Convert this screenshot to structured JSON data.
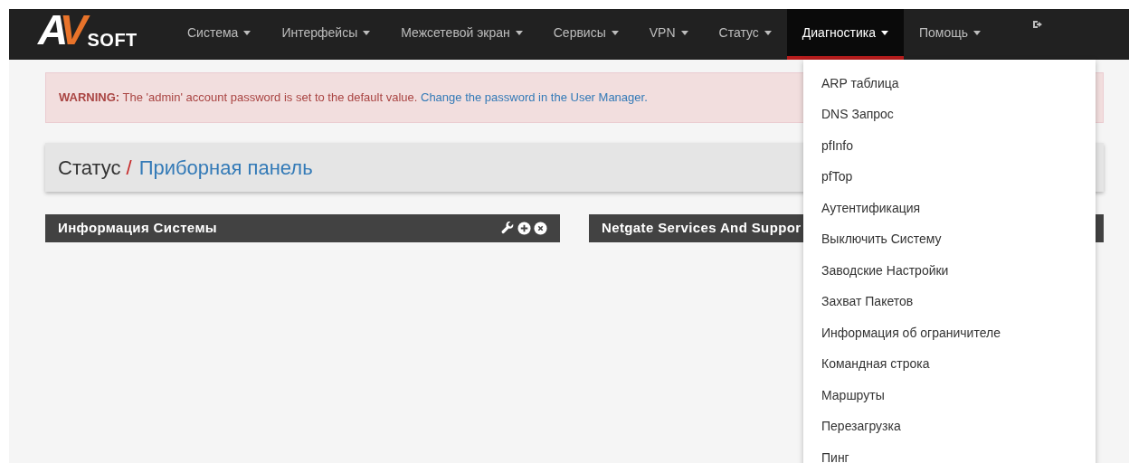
{
  "brand": {
    "mark_left": "A",
    "mark_right": "V",
    "name": "SOFT"
  },
  "nav": [
    {
      "label": "Система",
      "selected": false
    },
    {
      "label": "Интерфейсы",
      "selected": false
    },
    {
      "label": "Межсетевой экран",
      "selected": false
    },
    {
      "label": "Сервисы",
      "selected": false
    },
    {
      "label": "VPN",
      "selected": false
    },
    {
      "label": "Статус",
      "selected": false
    },
    {
      "label": "Диагностика",
      "selected": true
    },
    {
      "label": "Помощь",
      "selected": false
    }
  ],
  "warning": {
    "label": "WARNING:",
    "text": "The 'admin' account password is set to the default value.",
    "link": "Change the password in the User Manager."
  },
  "breadcrumb": {
    "parent": "Статус",
    "separator": "/",
    "current": "Приборная панель"
  },
  "widgets": [
    {
      "title": "Информация Системы",
      "controls": true
    },
    {
      "title": "Netgate Services And Suppor"
    }
  ],
  "dropdown": [
    "ARP таблица",
    "DNS Запрос",
    "pfInfo",
    "pfTop",
    "Аутентификация",
    "Выключить Систему",
    "Заводские Настройки",
    "Захват Пакетов",
    "Информация об ограничителе",
    "Командная строка",
    "Маршруты",
    "Перезагрузка",
    "Пинг"
  ]
}
